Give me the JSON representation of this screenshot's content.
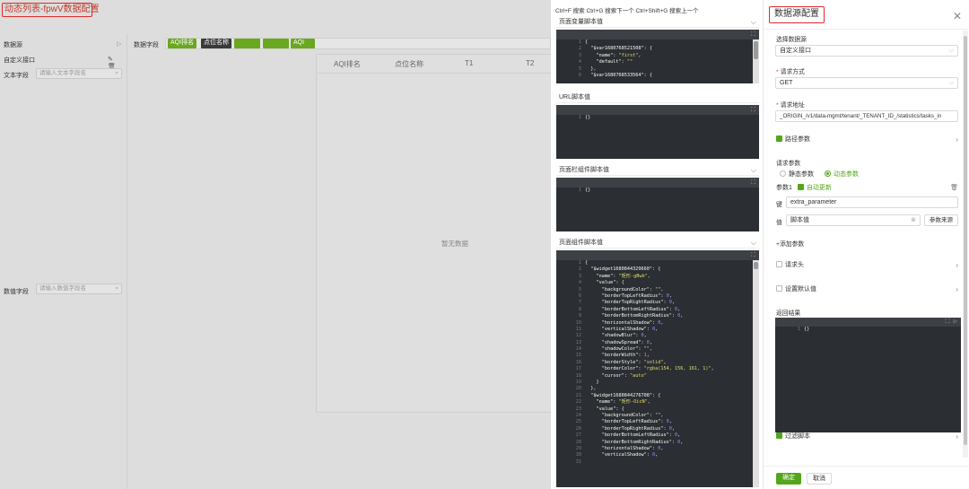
{
  "page": {
    "title": "动态列表-fpwV数据配置",
    "left": {
      "datasource_label": "数据源",
      "custom_api_label": "自定义接口",
      "text_field_label": "文本字段",
      "text_field_placeholder": "请输入文本字段名",
      "data_field_label": "数值字段",
      "data_field_placeholder": "请输入数值字段名",
      "data_field_top_label": "数据字段",
      "tags": [
        "AQI排名",
        "点位名称",
        "",
        "",
        "AQI"
      ],
      "grid_headers": [
        "AQI排名",
        "点位名称",
        "T1",
        "T2"
      ],
      "no_data": "暂无数据"
    }
  },
  "scripts": {
    "search_hint": "Ctrl+F 搜索 Ctrl+G 搜索下一个 Ctrl+Shift+G 搜索上一个",
    "sections": [
      {
        "label": "页面变量脚本值"
      },
      {
        "label": "URL脚本值"
      },
      {
        "label": "页面栏组件脚本值"
      },
      {
        "label": "页面组件脚本值"
      }
    ],
    "var_code": [
      {
        "n": "1",
        "t": "{"
      },
      {
        "n": "2",
        "t": "  \"$var1680768521508\": {"
      },
      {
        "n": "3",
        "t": "    \"name\": \"first\","
      },
      {
        "n": "4",
        "t": "    \"default\": \"\""
      },
      {
        "n": "5",
        "t": "  },"
      },
      {
        "n": "6",
        "t": "  \"$var1680768533564\": {"
      }
    ],
    "url_code": [
      {
        "n": "1",
        "t": "{}"
      }
    ],
    "bar_code": [
      {
        "n": "1",
        "t": "{}"
      }
    ],
    "widget_code": [
      {
        "n": "1",
        "t": "{"
      },
      {
        "n": "2",
        "t": "  \"$widget1680844329660\": {"
      },
      {
        "n": "3",
        "t": "    \"name\": \"矩形-gBwb\","
      },
      {
        "n": "4",
        "t": "    \"value\": {"
      },
      {
        "n": "5",
        "t": "      \"backgroundColor\": \"\","
      },
      {
        "n": "6",
        "t": "      \"borderTopLeftRadius\": 0,"
      },
      {
        "n": "7",
        "t": "      \"borderTopRightRadius\": 0,"
      },
      {
        "n": "8",
        "t": "      \"borderBottomLeftRadius\": 0,"
      },
      {
        "n": "9",
        "t": "      \"borderBottomRightRadius\": 0,"
      },
      {
        "n": "10",
        "t": "      \"horizontalShadow\": 0,"
      },
      {
        "n": "11",
        "t": "      \"verticalShadow\": 0,"
      },
      {
        "n": "12",
        "t": "      \"shadowBlur\": 0,"
      },
      {
        "n": "13",
        "t": "      \"shadowSpread\": 0,"
      },
      {
        "n": "14",
        "t": "      \"shadowColor\": \"\","
      },
      {
        "n": "15",
        "t": "      \"borderWidth\": 1,"
      },
      {
        "n": "16",
        "t": "      \"borderStyle\": \"solid\","
      },
      {
        "n": "17",
        "t": "      \"borderColor\": \"rgba(154, 156, 161, 1)\","
      },
      {
        "n": "18",
        "t": "      \"cursor\": \"auto\""
      },
      {
        "n": "19",
        "t": "    }"
      },
      {
        "n": "20",
        "t": "  },"
      },
      {
        "n": "21",
        "t": "  \"$widget1680844276708\": {"
      },
      {
        "n": "22",
        "t": "    \"name\": \"矩形-OicN\","
      },
      {
        "n": "23",
        "t": "    \"value\": {"
      },
      {
        "n": "24",
        "t": "      \"backgroundColor\": \"\","
      },
      {
        "n": "25",
        "t": "      \"borderTopLeftRadius\": 0,"
      },
      {
        "n": "26",
        "t": "      \"borderTopRightRadius\": 0,"
      },
      {
        "n": "27",
        "t": "      \"borderBottomLeftRadius\": 0,"
      },
      {
        "n": "28",
        "t": "      \"borderBottomRightRadius\": 0,"
      },
      {
        "n": "29",
        "t": "      \"horizontalShadow\": 0,"
      },
      {
        "n": "30",
        "t": "      \"verticalShadow\": 0,"
      },
      {
        "n": "31",
        "t": ""
      }
    ]
  },
  "config": {
    "title": "数据源配置",
    "select_datasource_label": "选择数据源",
    "datasource_value": "自定义接口",
    "method_label": "请求方式",
    "method_value": "GET",
    "url_label": "请求地址",
    "url_value": "_ORIGIN_/v1/data-mgmt/tenant/_TENANT_ID_/statistics/tasks_in",
    "path_params_label": "路径参数",
    "request_params_label": "请求参数",
    "static_params_label": "静态参数",
    "dynamic_params_label": "动态参数",
    "param1_label": "参数1",
    "auto_update_label": "自动更新",
    "key_label": "键",
    "key_value": "extra_parameter",
    "value_label": "值",
    "value_value": "脚本值",
    "param_source_label": "参数来源",
    "add_param_label": "+添加参数",
    "request_header_label": "请求头",
    "default_value_label": "设置默认值",
    "result_label": "返回结果",
    "result_code": [
      {
        "n": "1",
        "t": "{}"
      }
    ],
    "filter_script_label": "过滤脚本",
    "ok_label": "确定",
    "cancel_label": "取消",
    "accent": "#52a61b",
    "highlight": "#e0292b"
  }
}
